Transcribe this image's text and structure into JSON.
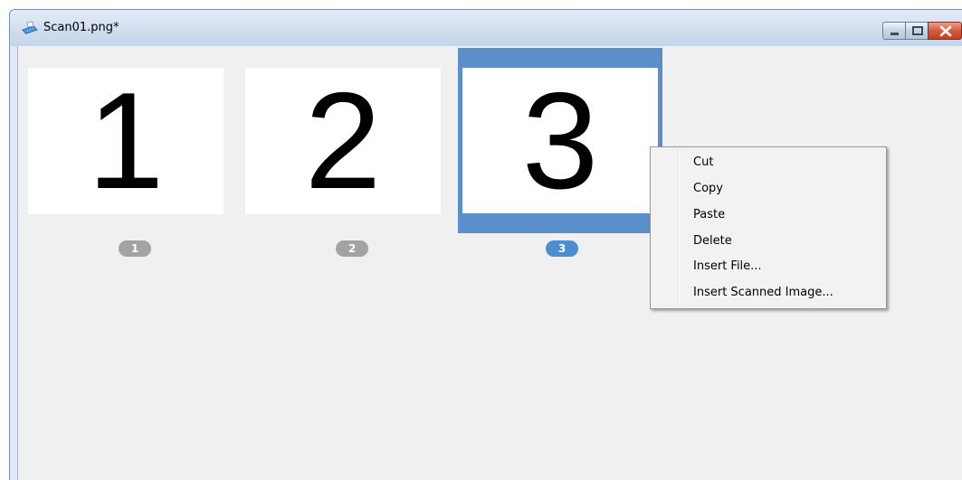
{
  "window": {
    "title": "Scan01.png*",
    "icon": "scanner-icon"
  },
  "caption_buttons": {
    "minimize_icon": "minimize-icon",
    "maximize_icon": "maximize-icon",
    "close_icon": "close-icon"
  },
  "pages": [
    {
      "content": "1",
      "badge": "1",
      "selected": false
    },
    {
      "content": "2",
      "badge": "2",
      "selected": false
    },
    {
      "content": "3",
      "badge": "3",
      "selected": true
    }
  ],
  "context_menu": {
    "items": [
      {
        "label": "Cut"
      },
      {
        "label": "Copy"
      },
      {
        "label": "Paste"
      },
      {
        "label": "Delete"
      },
      {
        "label": "Insert File..."
      },
      {
        "label": "Insert Scanned Image..."
      }
    ]
  },
  "colors": {
    "selection": "#5b8fcc",
    "badge_default": "#a3a3a3",
    "badge_selected": "#4d8ed0",
    "client_background": "#f0f0f0"
  }
}
